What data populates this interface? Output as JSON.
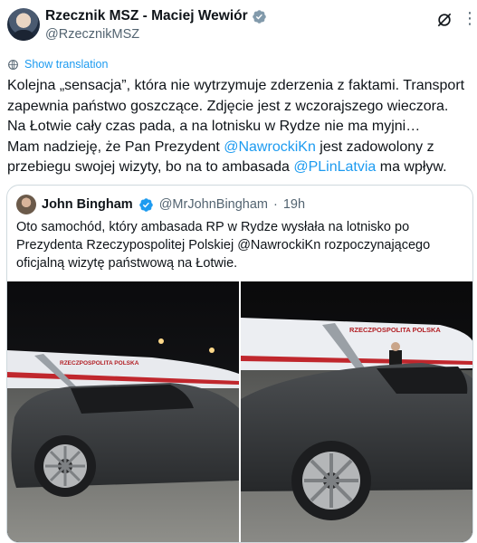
{
  "author": {
    "display_name": "Rzecznik MSZ - Maciej Wewiór",
    "handle": "@RzecznikMSZ"
  },
  "actions": {
    "grok_icon": "grok-icon",
    "more_icon": "more-icon",
    "more_glyph": "⋮"
  },
  "translate": {
    "label": "Show translation"
  },
  "tweet": {
    "part1": "Kolejna „sensacja”, która nie wytrzymuje zderzenia z faktami. Transport zapewnia państwo goszczące. Zdjęcie jest z wczorajszego wieczora. Na Łotwie cały czas pada, a na lotnisku w Rydze nie ma myjni…",
    "part2": "Mam nadzieję, że Pan Prezydent ",
    "mention1": "@NawrockiKn",
    "part3": " jest zadowolony z przebiegu swojej wizyty, bo na to ambasada ",
    "mention2": "@PLinLatvia",
    "part4": " ma wpływ."
  },
  "quote": {
    "name": "John Bingham",
    "handle": "@MrJohnBingham",
    "separator": "·",
    "time": "19h",
    "text": "Oto samochód, który ambasada RP w Rydze wysłała na lotnisko po Prezydenta Rzeczypospolitej Polskiej @NawrockiKn rozpoczynającego oficjalną wizytę państwową na Łotwie."
  },
  "photos": {
    "plane_lettering_left": "RZECZPOSPOLITA POLSKA",
    "plane_lettering_right": "RZECZPOSPOLITA POLSKA"
  },
  "colors": {
    "accent": "#1d9bf0",
    "text": "#0f1419",
    "secondary": "#536471",
    "border": "#cfd9de"
  }
}
